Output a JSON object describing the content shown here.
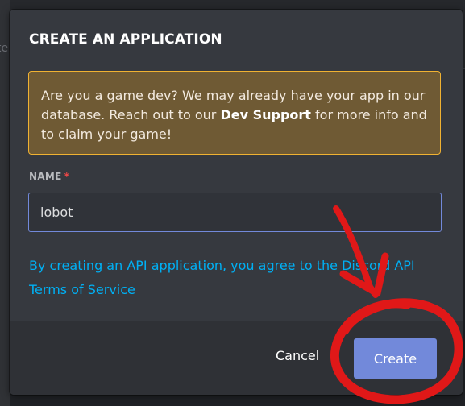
{
  "background": {
    "left_fragment_text": "te"
  },
  "modal": {
    "title": "CREATE AN APPLICATION",
    "notice": {
      "text_before": "Are you a game dev? We may already have your app in our database. Reach out to our ",
      "bold_text": "Dev Support",
      "text_after": " for more info and to claim your game!"
    },
    "name_field": {
      "label": "NAME",
      "required_marker": "*",
      "value": "lobot"
    },
    "terms": {
      "text": "By creating an API application, you agree to the Discord API",
      "link_text": "Terms of Service"
    },
    "footer": {
      "cancel_label": "Cancel",
      "create_label": "Create"
    }
  },
  "colors": {
    "modal_background": "#36393f",
    "footer_background": "#2f3136",
    "notice_background": "#6f5a34",
    "notice_border": "#f0b232",
    "input_border": "#7289da",
    "primary_button": "#7289da",
    "link": "#00b0f4",
    "required": "#f04747",
    "annotation": "#e01818"
  },
  "annotation": {
    "icon": "hand-drawn-arrow-and-circle",
    "target": "create-button"
  }
}
